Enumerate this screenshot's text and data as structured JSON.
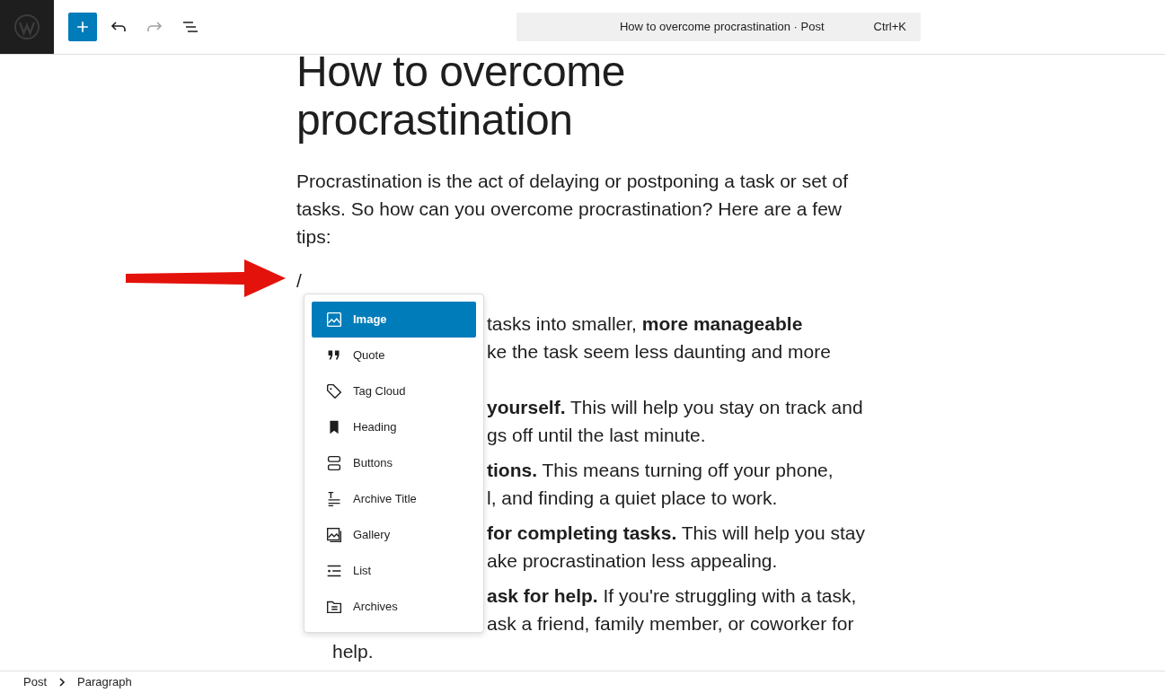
{
  "toolbar": {
    "undo_disabled": false,
    "redo_disabled": true
  },
  "command_bar": {
    "title": "How to overcome procrastination · Post",
    "shortcut": "Ctrl+K"
  },
  "post": {
    "title": "How to overcome procrastination",
    "intro": "Procrastination is the act of delaying or postponing a task or set of tasks. So how can you overcome procrastination? Here are a few tips:",
    "slash_command": "/",
    "list_items": [
      {
        "lines": [
          "tasks into smaller, **more manageable**",
          "ke the task seem less daunting and more"
        ]
      },
      {
        "lines": [
          "**yourself.** This will help you stay on track and",
          "gs off until the last minute."
        ]
      },
      {
        "lines": [
          "**tions.** This means turning off your phone,",
          "l, and finding a quiet place to work."
        ]
      },
      {
        "lines": [
          "**for completing tasks.** This will help you stay",
          "ake procrastination less appealing."
        ]
      },
      {
        "lines": [
          "**ask for help.** If you're struggling with a task,",
          "ask a friend, family member, or coworker for",
          "help."
        ]
      }
    ]
  },
  "block_inserter": {
    "items": [
      {
        "label": "Image",
        "kind": "image",
        "selected": true
      },
      {
        "label": "Quote",
        "kind": "quote",
        "selected": false
      },
      {
        "label": "Tag Cloud",
        "kind": "tag",
        "selected": false
      },
      {
        "label": "Heading",
        "kind": "bookmark",
        "selected": false
      },
      {
        "label": "Buttons",
        "kind": "buttons",
        "selected": false
      },
      {
        "label": "Archive Title",
        "kind": "title",
        "selected": false
      },
      {
        "label": "Gallery",
        "kind": "gallery",
        "selected": false
      },
      {
        "label": "List",
        "kind": "list",
        "selected": false
      },
      {
        "label": "Archives",
        "kind": "folder",
        "selected": false
      }
    ]
  },
  "breadcrumbs": [
    "Post",
    "Paragraph"
  ]
}
